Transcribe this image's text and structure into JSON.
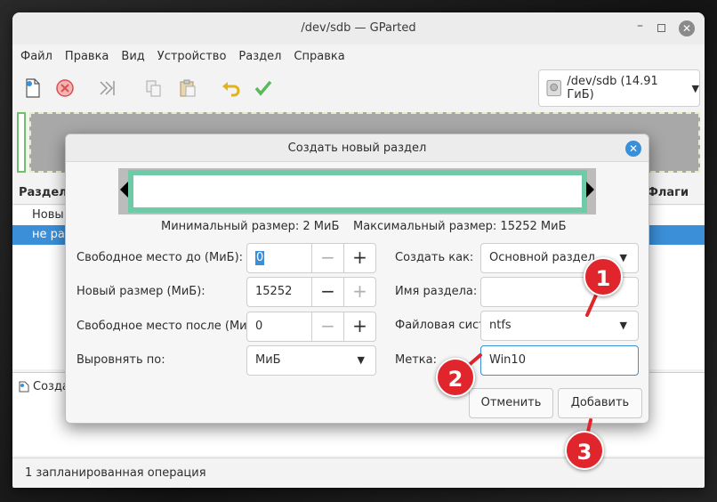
{
  "window": {
    "title": "/dev/sdb — GParted",
    "min_glyph": "–",
    "close_glyph": "✕"
  },
  "menu": {
    "items": [
      "Файл",
      "Правка",
      "Вид",
      "Устройство",
      "Раздел",
      "Справка"
    ]
  },
  "toolbar": {
    "device_label": "/dev/sdb (14.91 ГиБ)",
    "device_caret": "▼"
  },
  "partitions": {
    "header_partition": "Раздел",
    "header_flags": "Флаги",
    "rows": [
      "Новы",
      "не раз"
    ]
  },
  "operations": {
    "item": "Созда"
  },
  "status": {
    "text": "1 запланированная операция"
  },
  "dialog": {
    "title": "Создать новый раздел",
    "close_glyph": "✕",
    "min_size": "Минимальный размер: 2 МиБ",
    "max_size": "Максимальный размер: 15252 МиБ",
    "free_before_label": "Свободное место до (МиБ):",
    "free_before_value": "0",
    "new_size_label": "Новый размер (МиБ):",
    "new_size_value": "15252",
    "free_after_label": "Свободное место после (МиБ):",
    "free_after_value": "0",
    "align_label": "Выровнять по:",
    "align_value": "МиБ",
    "create_as_label": "Создать как:",
    "create_as_value": "Основной раздел",
    "part_name_label": "Имя раздела:",
    "part_name_value": "",
    "fs_label": "Файловая система:",
    "fs_value": "ntfs",
    "label_label": "Метка:",
    "label_value": "Win10",
    "cancel_label": "Отменить",
    "add_label": "Добавить",
    "minus_glyph": "−",
    "plus_glyph": "+",
    "caret_glyph": "▼"
  },
  "annotations": {
    "badge1": "1",
    "badge2": "2",
    "badge3": "3",
    "color": "#e0262c"
  },
  "colors": {
    "accent": "#3a8fd9",
    "selected_row": "#3b8fd8",
    "resizer_border": "#6fcaa8",
    "unallocated": "#a8a8a8",
    "partition_green": "#6ec06b"
  }
}
